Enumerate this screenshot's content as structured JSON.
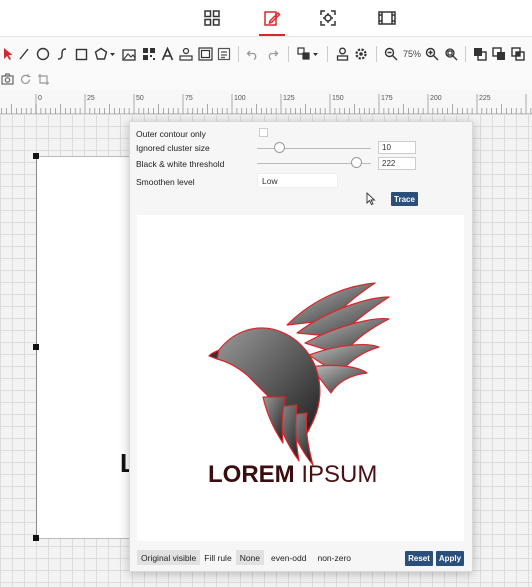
{
  "panel": {
    "outer_contour_label": "Outer contour only",
    "ignored_cluster_label": "Ignored cluster size",
    "ignored_cluster_value": "10",
    "bw_threshold_label": "Black & white threshold",
    "bw_threshold_value": "222",
    "smoothen_label": "Smoothen level",
    "smoothen_value": "Low",
    "trace_label": "Trace"
  },
  "preview": {
    "logo_word1": "LOREM",
    "logo_word2": "IPSUM"
  },
  "bottom_bar": {
    "original_visible": "Original visible",
    "fill_rule_label": "Fill rule",
    "fill_none": "None",
    "fill_even_odd": "even-odd",
    "fill_non_zero": "non-zero",
    "reset_label": "Reset",
    "apply_label": "Apply"
  },
  "toolbar": {
    "zoom_level": "75%"
  },
  "ruler": {
    "ticks": [
      "0",
      "25",
      "50",
      "75",
      "100",
      "125",
      "150",
      "175",
      "200",
      "225"
    ]
  },
  "canvas": {
    "partial_letter": "L"
  },
  "colors": {
    "accent_red": "#d9262c",
    "button_blue": "#2b4f7a",
    "logo_text": "#3b0d10"
  },
  "icons": [
    "layout-grid-icon",
    "edit-pen-icon",
    "crosshair-center-icon",
    "film-frame-icon"
  ]
}
